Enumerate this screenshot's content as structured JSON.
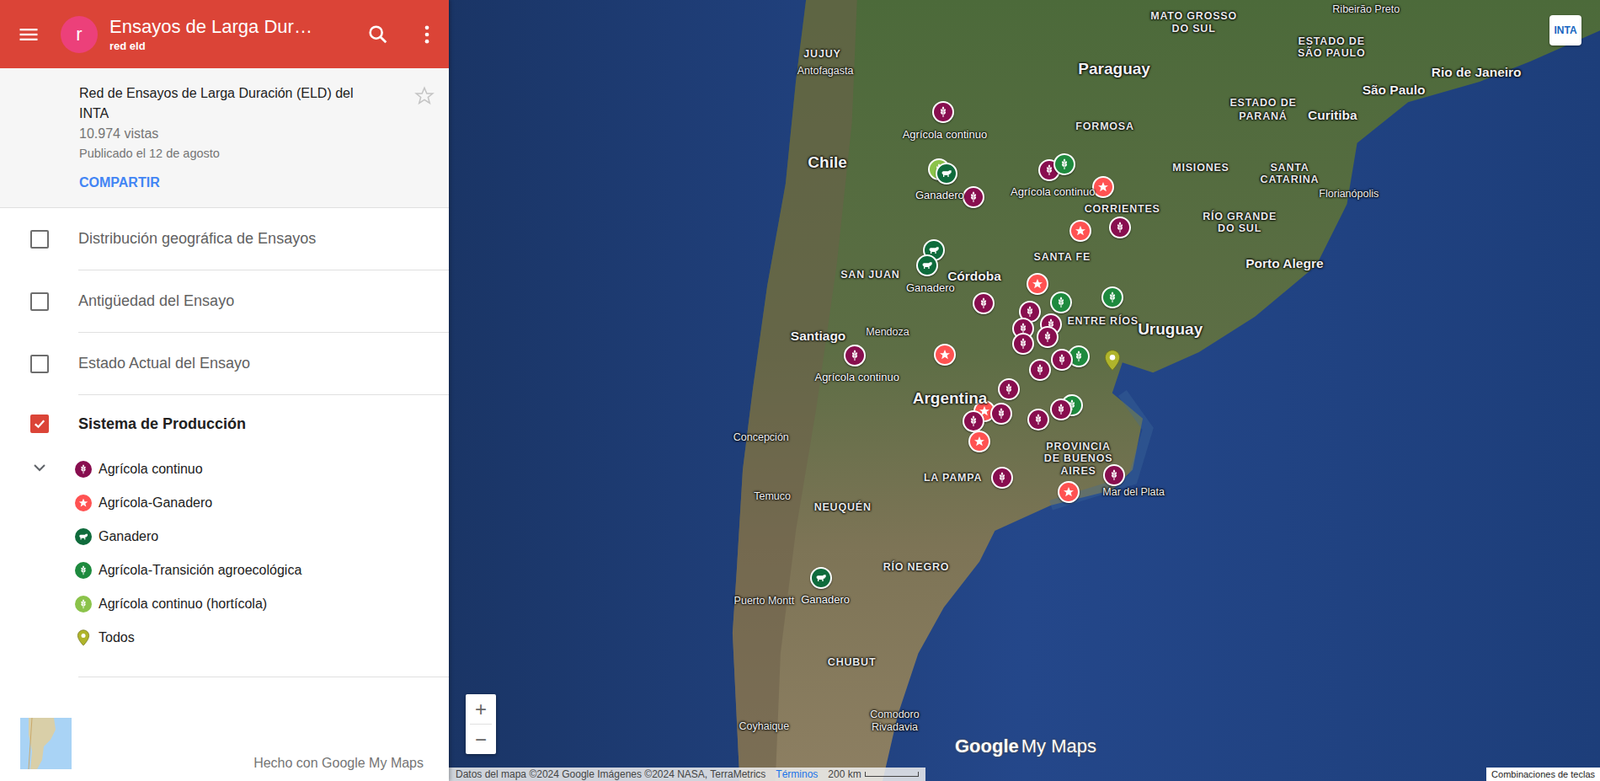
{
  "app": {
    "title": "Ensayos de Larga Dur…",
    "subtitle": "red eld",
    "avatar": "r"
  },
  "map_info": {
    "name": "Red de Ensayos de Larga Duración (ELD) del INTA",
    "views": "10.974 vistas",
    "published": "Publicado el 12 de agosto",
    "share": "COMPARTIR",
    "starred": false
  },
  "layers": [
    {
      "name": "Distribución geográfica de Ensayos",
      "checked": false
    },
    {
      "name": "Antigüedad del Ensayo",
      "checked": false
    },
    {
      "name": "Estado Actual del Ensayo",
      "checked": false
    },
    {
      "name": "Sistema de Producción",
      "checked": true,
      "expanded": true,
      "legend": [
        {
          "label": "Agrícola continuo",
          "kind": "wheat",
          "color": "#880e4f"
        },
        {
          "label": "Agrícola-Ganadero",
          "kind": "star",
          "color": "#ff5252"
        },
        {
          "label": "Ganadero",
          "kind": "cow",
          "color": "#0f6b3c"
        },
        {
          "label": "Agrícola-Transición agroecológica",
          "kind": "wheat",
          "color": "#1e8a3e"
        },
        {
          "label": "Agrícola continuo (hortícola)",
          "kind": "wheat",
          "color": "#8bc34a"
        },
        {
          "label": "Todos",
          "kind": "pin",
          "color": "#afb42b"
        }
      ]
    }
  ],
  "footer": "Hecho con Google My Maps",
  "map": {
    "places": [
      {
        "text": "Paraguay",
        "kind": "country"
      },
      {
        "text": "Chile",
        "kind": "country"
      },
      {
        "text": "Uruguay",
        "kind": "country"
      },
      {
        "text": "Argentina",
        "kind": "country"
      },
      {
        "text": "JUJUY",
        "kind": "region"
      },
      {
        "text": "MATO GROSSO",
        "kind": "region"
      },
      {
        "text": "DO SUL",
        "kind": "region"
      },
      {
        "text": "ESTADO DE",
        "kind": "region"
      },
      {
        "text": "SÃO PAULO",
        "kind": "region"
      },
      {
        "text": "ESTADO DE",
        "kind": "region"
      },
      {
        "text": "PARANÁ",
        "kind": "region"
      },
      {
        "text": "FORMOSA",
        "kind": "region"
      },
      {
        "text": "MISIONES",
        "kind": "region"
      },
      {
        "text": "SANTA",
        "kind": "region"
      },
      {
        "text": "CATARINA",
        "kind": "region"
      },
      {
        "text": "CORRIENTES",
        "kind": "region"
      },
      {
        "text": "RÍO GRANDE",
        "kind": "region"
      },
      {
        "text": "DO SUL",
        "kind": "region"
      },
      {
        "text": "SANTA FE",
        "kind": "region"
      },
      {
        "text": "SAN JUAN",
        "kind": "region"
      },
      {
        "text": "ENTRE RÍOS",
        "kind": "region"
      },
      {
        "text": "PROVINCIA",
        "kind": "region"
      },
      {
        "text": "DE BUENOS",
        "kind": "region"
      },
      {
        "text": "AIRES",
        "kind": "region"
      },
      {
        "text": "LA PAMPA",
        "kind": "region"
      },
      {
        "text": "NEUQUÉN",
        "kind": "region"
      },
      {
        "text": "RÍO NEGRO",
        "kind": "region"
      },
      {
        "text": "CHUBUT",
        "kind": "region"
      },
      {
        "text": "Ribeirão Preto",
        "kind": "city"
      },
      {
        "text": "Antofagasta",
        "kind": "city"
      },
      {
        "text": "São Paulo",
        "kind": "major"
      },
      {
        "text": "Rio de Janeiro",
        "kind": "major"
      },
      {
        "text": "Curitiba",
        "kind": "major"
      },
      {
        "text": "Florianópolis",
        "kind": "city"
      },
      {
        "text": "Porto Alegre",
        "kind": "major"
      },
      {
        "text": "Córdoba",
        "kind": "major"
      },
      {
        "text": "Santiago",
        "kind": "major"
      },
      {
        "text": "Mendoza",
        "kind": "city"
      },
      {
        "text": "Concepción",
        "kind": "city"
      },
      {
        "text": "Mar del Plata",
        "kind": "city"
      },
      {
        "text": "Temuco",
        "kind": "city"
      },
      {
        "text": "Puerto Montt",
        "kind": "city"
      },
      {
        "text": "Comodoro",
        "kind": "city"
      },
      {
        "text": "Rivadavia",
        "kind": "city"
      },
      {
        "text": "Coyhaique",
        "kind": "city"
      }
    ],
    "pins": [
      {
        "kind": "wheat",
        "color": "#880e4f",
        "label": "Agrícola continuo"
      },
      {
        "kind": "wheat",
        "color": "#8bc34a"
      },
      {
        "kind": "cow",
        "color": "#0f6b3c",
        "label": "Ganadero"
      },
      {
        "kind": "wheat",
        "color": "#880e4f"
      },
      {
        "kind": "wheat",
        "color": "#880e4f",
        "label": "Agrícola continuo"
      },
      {
        "kind": "wheat",
        "color": "#1e8a3e"
      },
      {
        "kind": "star",
        "color": "#ff5252"
      },
      {
        "kind": "star",
        "color": "#ff5252"
      },
      {
        "kind": "wheat",
        "color": "#880e4f"
      },
      {
        "kind": "cow",
        "color": "#0f6b3c"
      },
      {
        "kind": "cow",
        "color": "#0f6b3c",
        "label": "Ganadero"
      },
      {
        "kind": "star",
        "color": "#ff5252"
      },
      {
        "kind": "wheat",
        "color": "#880e4f"
      },
      {
        "kind": "wheat",
        "color": "#1e8a3e"
      },
      {
        "kind": "wheat",
        "color": "#880e4f"
      },
      {
        "kind": "wheat",
        "color": "#1e8a3e"
      },
      {
        "kind": "wheat",
        "color": "#880e4f"
      },
      {
        "kind": "wheat",
        "color": "#880e4f"
      },
      {
        "kind": "wheat",
        "color": "#880e4f"
      },
      {
        "kind": "wheat",
        "color": "#880e4f"
      },
      {
        "kind": "wheat",
        "color": "#1e8a3e"
      },
      {
        "kind": "wheat",
        "color": "#880e4f"
      },
      {
        "kind": "wheat",
        "color": "#880e4f"
      },
      {
        "kind": "wheat",
        "color": "#880e4f",
        "label": "Agrícola continuo"
      },
      {
        "kind": "star",
        "color": "#ff5252"
      },
      {
        "kind": "pin",
        "color": "#afb42b"
      },
      {
        "kind": "wheat",
        "color": "#880e4f"
      },
      {
        "kind": "star",
        "color": "#ff5252"
      },
      {
        "kind": "wheat",
        "color": "#880e4f"
      },
      {
        "kind": "wheat",
        "color": "#880e4f"
      },
      {
        "kind": "star",
        "color": "#ff5252"
      },
      {
        "kind": "wheat",
        "color": "#1e8a3e"
      },
      {
        "kind": "wheat",
        "color": "#880e4f"
      },
      {
        "kind": "wheat",
        "color": "#880e4f"
      },
      {
        "kind": "wheat",
        "color": "#880e4f"
      },
      {
        "kind": "wheat",
        "color": "#880e4f"
      },
      {
        "kind": "star",
        "color": "#ff5252"
      },
      {
        "kind": "cow",
        "color": "#0f6b3c",
        "label": "Ganadero"
      }
    ],
    "zoom_in": "+",
    "zoom_out": "−",
    "logo": {
      "google": "Google",
      "product": "My Maps"
    },
    "attribution": "Datos del mapa ©2024 Google Imágenes ©2024 NASA, TerraMetrics",
    "terms": "Términos",
    "scale": "200 km",
    "shortcuts": "Combinaciones de teclas",
    "brand": "INTA"
  }
}
